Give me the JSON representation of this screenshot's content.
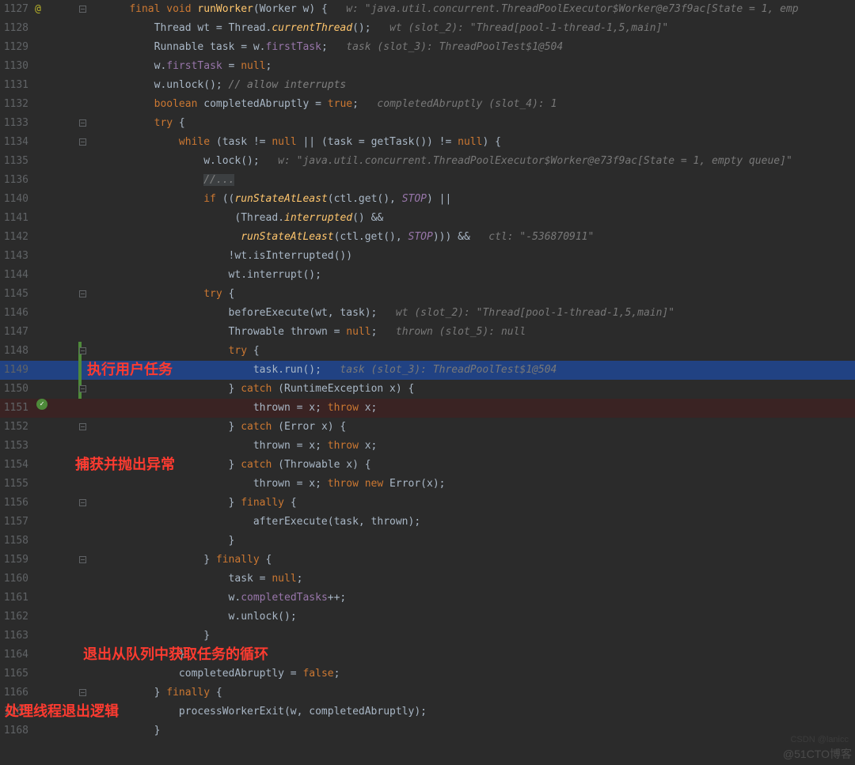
{
  "lineNumbers": [
    "1127",
    "1128",
    "1129",
    "1130",
    "1131",
    "1132",
    "1133",
    "1134",
    "1135",
    "1136",
    "1140",
    "1141",
    "1142",
    "1143",
    "1144",
    "1145",
    "1146",
    "1147",
    "1148",
    "1149",
    "1150",
    "1151",
    "1152",
    "1153",
    "1154",
    "1155",
    "1156",
    "1157",
    "1158",
    "1159",
    "1160",
    "1161",
    "1162",
    "1163",
    "1164",
    "1165",
    "1166",
    "1167",
    "1168"
  ],
  "code": {
    "l1127": {
      "indent": "    ",
      "tokens": [
        "final",
        " ",
        "void",
        " ",
        "runWorker",
        "(Worker w) {   "
      ],
      "hint": "w: \"java.util.concurrent.ThreadPoolExecutor$Worker@e73f9ac[State = 1, emp"
    },
    "l1128": {
      "indent": "        ",
      "tokens": [
        "Thread wt = Thread.",
        "currentThread",
        "();   "
      ],
      "hint": "wt (slot_2): \"Thread[pool-1-thread-1,5,main]\""
    },
    "l1129": {
      "indent": "        ",
      "tokens": [
        "Runnable task = w.",
        "firstTask",
        ";   "
      ],
      "hint": "task (slot_3): ThreadPoolTest$1@504"
    },
    "l1130": {
      "indent": "        ",
      "tokens": [
        "w.",
        "firstTask",
        " = ",
        "null",
        ";"
      ]
    },
    "l1131": {
      "indent": "        ",
      "tokens": [
        "w.unlock(); ",
        "// allow interrupts"
      ]
    },
    "l1132": {
      "indent": "        ",
      "tokens": [
        "boolean",
        " completedAbruptly = ",
        "true",
        ";   "
      ],
      "hint": "completedAbruptly (slot_4): 1"
    },
    "l1133": {
      "indent": "        ",
      "tokens": [
        "try",
        " {"
      ]
    },
    "l1134": {
      "indent": "            ",
      "tokens": [
        "while",
        " (task != ",
        "null",
        " || (task = getTask()) != ",
        "null",
        ") {"
      ]
    },
    "l1135": {
      "indent": "                ",
      "tokens": [
        "w.lock();   "
      ],
      "hint": "w: \"java.util.concurrent.ThreadPoolExecutor$Worker@e73f9ac[State = 1, empty queue]\""
    },
    "l1136": {
      "indent": "                ",
      "tokens": [
        "//..."
      ]
    },
    "l1140": {
      "indent": "                ",
      "tokens": [
        "if",
        " ((",
        "runStateAtLeast",
        "(ctl.get(), ",
        "STOP",
        ") ||"
      ]
    },
    "l1141": {
      "indent": "                     ",
      "tokens": [
        "(Thread.",
        "interrupted",
        "() &&"
      ]
    },
    "l1142": {
      "indent": "                      ",
      "tokens": [
        "runStateAtLeast",
        "(ctl.get(), ",
        "STOP",
        "))) &&   "
      ],
      "hint": "ctl: \"-536870911\""
    },
    "l1143": {
      "indent": "                    ",
      "tokens": [
        "!wt.isInterrupted())"
      ]
    },
    "l1144": {
      "indent": "                    ",
      "tokens": [
        "wt.interrupt();"
      ]
    },
    "l1145": {
      "indent": "                ",
      "tokens": [
        "try",
        " {"
      ]
    },
    "l1146": {
      "indent": "                    ",
      "tokens": [
        "beforeExecute(wt, task);   "
      ],
      "hint": "wt (slot_2): \"Thread[pool-1-thread-1,5,main]\""
    },
    "l1147": {
      "indent": "                    ",
      "tokens": [
        "Throwable thrown = ",
        "null",
        ";   "
      ],
      "hint": "thrown (slot_5): null"
    },
    "l1148": {
      "indent": "                    ",
      "tokens": [
        "try",
        " {"
      ]
    },
    "l1149": {
      "indent": "                        ",
      "tokens": [
        "task.run();   "
      ],
      "hint": "task (slot_3): ThreadPoolTest$1@504"
    },
    "l1150": {
      "indent": "                    ",
      "tokens": [
        "} ",
        "catch",
        " (RuntimeException x) {"
      ]
    },
    "l1151": {
      "indent": "                        ",
      "tokens": [
        "thrown = x; ",
        "throw",
        " x;"
      ]
    },
    "l1152": {
      "indent": "                    ",
      "tokens": [
        "} ",
        "catch",
        " (Error x) {"
      ]
    },
    "l1153": {
      "indent": "                        ",
      "tokens": [
        "thrown = x; ",
        "throw",
        " x;"
      ]
    },
    "l1154": {
      "indent": "                    ",
      "tokens": [
        "} ",
        "catch",
        " (Throwable x) {"
      ]
    },
    "l1155": {
      "indent": "                        ",
      "tokens": [
        "thrown = x; ",
        "throw new",
        " Error(x);"
      ]
    },
    "l1156": {
      "indent": "                    ",
      "tokens": [
        "} ",
        "finally",
        " {"
      ]
    },
    "l1157": {
      "indent": "                        ",
      "tokens": [
        "afterExecute(task, thrown);"
      ]
    },
    "l1158": {
      "indent": "                    ",
      "tokens": [
        "}"
      ]
    },
    "l1159": {
      "indent": "                ",
      "tokens": [
        "} ",
        "finally",
        " {"
      ]
    },
    "l1160": {
      "indent": "                    ",
      "tokens": [
        "task = ",
        "null",
        ";"
      ]
    },
    "l1161": {
      "indent": "                    ",
      "tokens": [
        "w.",
        "completedTasks",
        "++;"
      ]
    },
    "l1162": {
      "indent": "                    ",
      "tokens": [
        "w.unlock();"
      ]
    },
    "l1163": {
      "indent": "                ",
      "tokens": [
        "}"
      ]
    },
    "l1164": {
      "indent": "            ",
      "tokens": [
        "}"
      ]
    },
    "l1165": {
      "indent": "            ",
      "tokens": [
        "completedAbruptly = ",
        "false",
        ";"
      ]
    },
    "l1166": {
      "indent": "        ",
      "tokens": [
        "} ",
        "finally",
        " {"
      ]
    },
    "l1167": {
      "indent": "            ",
      "tokens": [
        "processWorkerExit(w, completedAbruptly);"
      ]
    },
    "l1168": {
      "indent": "        ",
      "tokens": [
        "}"
      ]
    }
  },
  "annotations": {
    "a1": "执行用户任务",
    "a2": "捕获并抛出异常",
    "a3": "退出从队列中获取任务的循环",
    "a4": "处理线程退出逻辑"
  },
  "gutterIcons": {
    "at": "@",
    "check": "✓"
  },
  "watermark": "@51CTO博客",
  "watermark2": "CSDN @lanicc"
}
